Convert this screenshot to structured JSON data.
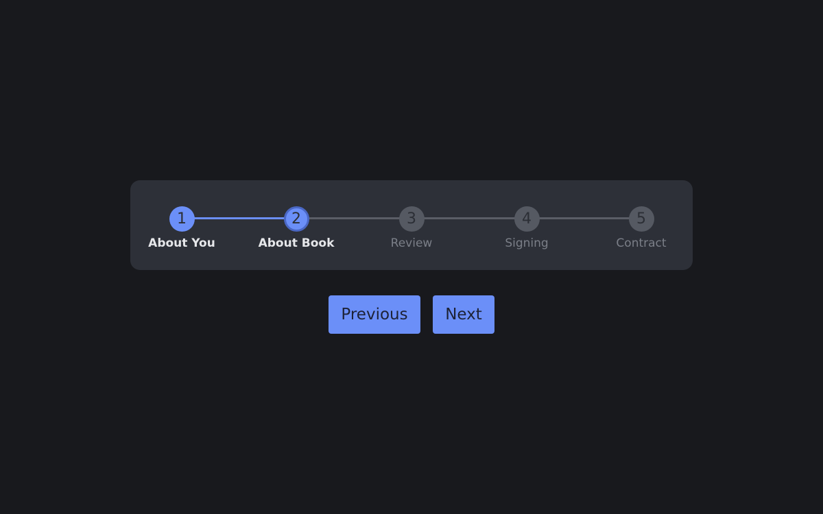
{
  "stepper": {
    "steps": [
      {
        "number": "1",
        "label": "About You",
        "state": "complete"
      },
      {
        "number": "2",
        "label": "About Book",
        "state": "current"
      },
      {
        "number": "3",
        "label": "Review",
        "state": "upcoming"
      },
      {
        "number": "4",
        "label": "Signing",
        "state": "upcoming"
      },
      {
        "number": "5",
        "label": "Contract",
        "state": "upcoming"
      }
    ]
  },
  "buttons": {
    "previous_label": "Previous",
    "next_label": "Next"
  },
  "colors": {
    "background": "#18191d",
    "card": "#2d3038",
    "accent": "#6b8ff8",
    "inactive_step": "#555962",
    "inactive_text": "#7b7f88"
  }
}
